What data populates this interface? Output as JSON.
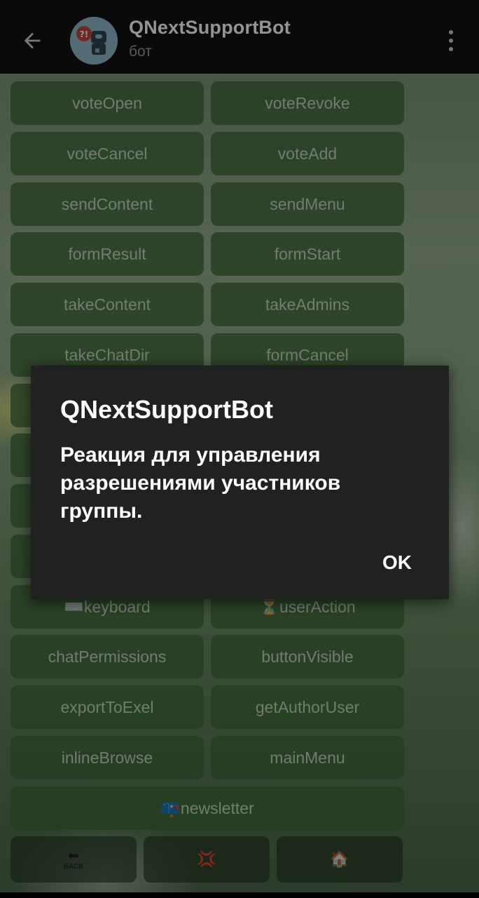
{
  "header": {
    "title": "QNextSupportBot",
    "subtitle": "бот"
  },
  "keyboard": {
    "rows": [
      [
        "voteOpen",
        "voteRevoke"
      ],
      [
        "voteCancel",
        "voteAdd"
      ],
      [
        "sendContent",
        "sendMenu"
      ],
      [
        "formResult",
        "formStart"
      ],
      [
        "takeContent",
        "takeAdmins"
      ],
      [
        "takeChatDir",
        "formCancel"
      ]
    ],
    "rows_lower": [
      [
        "⌨️keyboard",
        "⏳userAction"
      ],
      [
        "chatPermissions",
        "buttonVisible"
      ],
      [
        "exportToExel",
        "getAuthorUser"
      ],
      [
        "inlineBrowse",
        "mainMenu"
      ]
    ],
    "newsletter": "📪newsletter",
    "bottom": {
      "back_label": "BACK",
      "back_icon": "⬅",
      "middle_icon": "💢",
      "home_icon": "🏠"
    }
  },
  "dialog": {
    "title": "QNextSupportBot",
    "message": "Реакция для управления разрешениями участников группы.",
    "ok_label": "OK"
  }
}
